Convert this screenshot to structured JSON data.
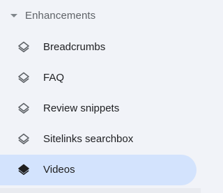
{
  "section": {
    "label": "Enhancements",
    "expanded": true
  },
  "items": [
    {
      "label": "Breadcrumbs",
      "icon": "layers-outline-icon",
      "active": false
    },
    {
      "label": "FAQ",
      "icon": "layers-outline-icon",
      "active": false
    },
    {
      "label": "Review snippets",
      "icon": "layers-outline-icon",
      "active": false
    },
    {
      "label": "Sitelinks searchbox",
      "icon": "layers-outline-icon",
      "active": false
    },
    {
      "label": "Videos",
      "icon": "layers-outline-icon",
      "active": true
    }
  ],
  "colors": {
    "background": "#f1f3f8",
    "active_background": "#d3e3fd",
    "icon_inactive": "#5f6368",
    "icon_active": "#1f1f1f",
    "text": "#202124",
    "section_text": "#5f6368"
  }
}
